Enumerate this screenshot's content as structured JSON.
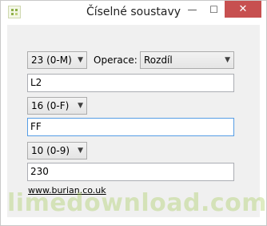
{
  "window": {
    "title": "Číselné soustavy"
  },
  "titlebar_buttons": {
    "minimize": "—",
    "maximize": "☐",
    "close": "✕"
  },
  "row1": {
    "base_select": "23 (0-M)",
    "operation_label": "Operace:",
    "operation_select": "Rozdíl"
  },
  "field1": {
    "value": "L2"
  },
  "row2": {
    "base_select": "16 (0-F)"
  },
  "field2": {
    "value": "FF"
  },
  "row3": {
    "base_select": "10 (0-9)"
  },
  "field3": {
    "value": "230"
  },
  "footer": {
    "link": "www.burian.co.uk",
    "watermark": "limedownload.com"
  }
}
